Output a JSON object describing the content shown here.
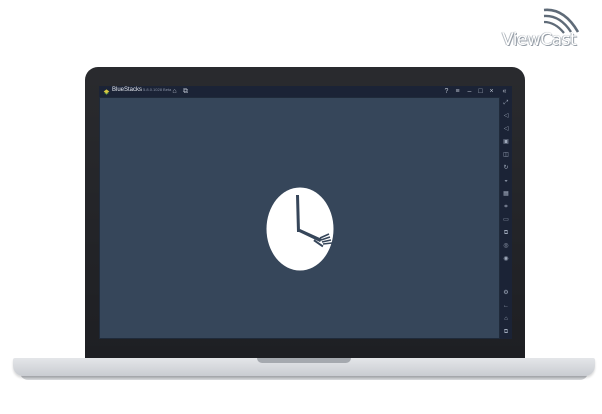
{
  "watermark": {
    "brand_text": "ViewCast"
  },
  "window": {
    "app_name": "BlueStacks",
    "app_version": "5.8.0.1028 Beta",
    "titlebar_icons": [
      "home-icon",
      "multi-instance-icon",
      "help-icon",
      "menu-icon",
      "minimize-icon",
      "maximize-icon",
      "close-icon",
      "collapse-sidebar-icon"
    ]
  },
  "sidebar": {
    "icons": [
      "fullscreen-icon",
      "volume-up-icon",
      "volume-down-icon",
      "keyboard-controls-icon",
      "screenshot-icon",
      "rotate-icon",
      "game-mode-icon",
      "macro-icon",
      "scale-icon",
      "folder-icon",
      "multi-instance-icon",
      "eco-mode-icon",
      "sync-icon",
      "settings-icon",
      "back-icon",
      "home-icon",
      "recent-apps-icon"
    ]
  },
  "content": {
    "logo": "clock-fork-icon"
  },
  "colors": {
    "viewport": "#36465a",
    "chrome": "#1b2336",
    "laptop_lid": "#1e1f23"
  }
}
